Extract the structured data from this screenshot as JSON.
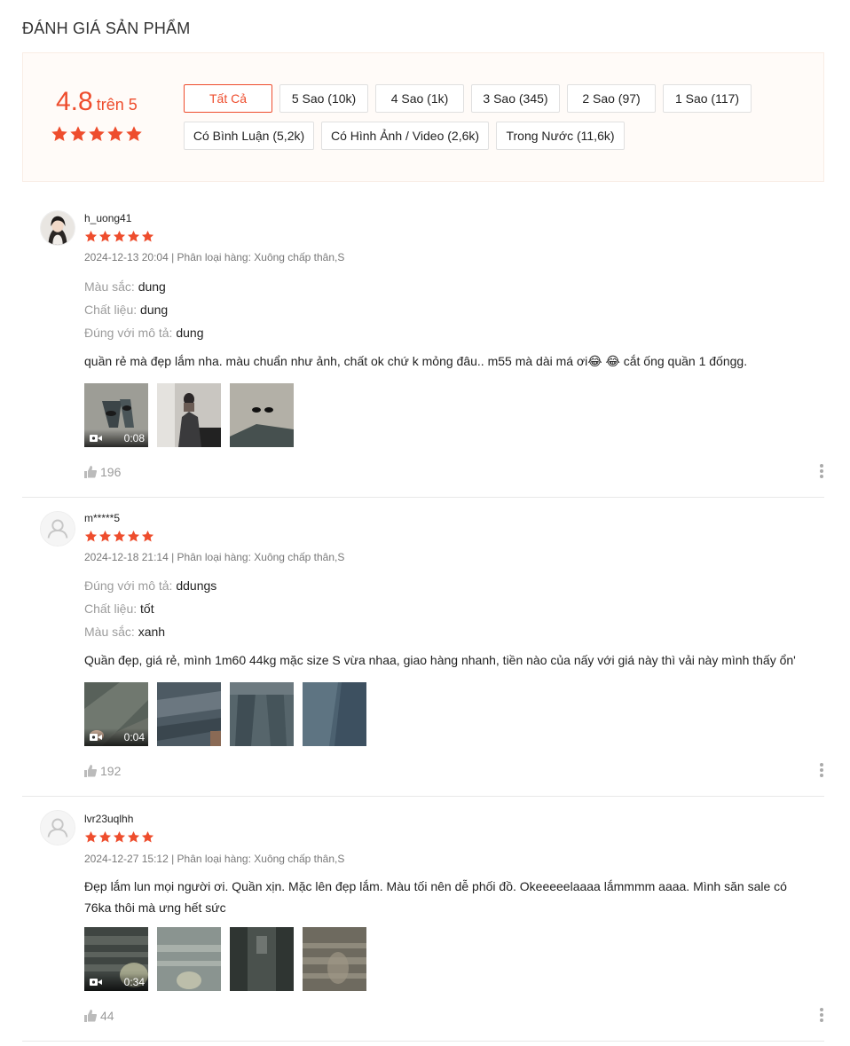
{
  "section_title": "ĐÁNH GIÁ SẢN PHẨM",
  "rating_overview": {
    "score": "4.8",
    "out_of": "trên 5",
    "stars_rating": 5,
    "filters": [
      {
        "label": "Tất Cả",
        "active": true
      },
      {
        "label": "5 Sao (10k)"
      },
      {
        "label": "4 Sao (1k)"
      },
      {
        "label": "3 Sao (345)"
      },
      {
        "label": "2 Sao (97)"
      },
      {
        "label": "1 Sao (117)"
      },
      {
        "label": "Có Bình Luận (5,2k)"
      },
      {
        "label": "Có Hình Ảnh / Video (2,6k)"
      },
      {
        "label": "Trong Nước (11,6k)"
      }
    ]
  },
  "colors": {
    "accent": "#ee4d2d",
    "star": "#ee4d2d",
    "overview_bg": "#fffbf8"
  },
  "reviews": [
    {
      "username": "h_uong41",
      "avatar": "photo",
      "stars": 5,
      "meta": "2024-12-13 20:04 | Phân loại hàng: Xuông chấp thân,S",
      "attributes": [
        {
          "key": "Màu sắc:",
          "value": "dung"
        },
        {
          "key": "Chất liệu:",
          "value": "dung"
        },
        {
          "key": "Đúng với mô tả:",
          "value": "dung"
        }
      ],
      "comment": "quần rẻ mà đẹp lắm nha. màu chuẩn như ảnh, chất ok chứ k mỏng đâu.. m55 mà dài má ơi😂 😂 cắt ống quần 1 đốngg.",
      "media": [
        {
          "type": "video",
          "duration": "0:08"
        },
        {
          "type": "image"
        },
        {
          "type": "image"
        }
      ],
      "likes": "196"
    },
    {
      "username": "m*****5",
      "avatar": "default",
      "stars": 5,
      "meta": "2024-12-18 21:14 | Phân loại hàng: Xuông chấp thân,S",
      "attributes": [
        {
          "key": "Đúng với mô tả:",
          "value": "ddungs"
        },
        {
          "key": "Chất liệu:",
          "value": "tốt"
        },
        {
          "key": "Màu sắc:",
          "value": "xanh"
        }
      ],
      "comment": "Quần đẹp, giá rẻ, mình 1m60 44kg mặc size S vừa nhaa, giao hàng nhanh, tiền nào của nấy với giá này thì vải này mình thấy ổn'",
      "media": [
        {
          "type": "video",
          "duration": "0:04"
        },
        {
          "type": "image"
        },
        {
          "type": "image"
        },
        {
          "type": "image"
        }
      ],
      "likes": "192"
    },
    {
      "username": "lvr23uqlhh",
      "avatar": "default",
      "stars": 5,
      "meta": "2024-12-27 15:12 | Phân loại hàng: Xuông chấp thân,S",
      "attributes": [],
      "comment": "Đẹp lắm lun mọi người ơi. Quần xịn. Mặc lên đẹp lắm. Màu tối nên dễ phối đồ. Okeeeeelaaaa lắmmmm aaaa. Mình săn sale có 76ka thôi mà ưng hết sức",
      "media": [
        {
          "type": "video",
          "duration": "0:34"
        },
        {
          "type": "image"
        },
        {
          "type": "image"
        },
        {
          "type": "image"
        }
      ],
      "likes": "44"
    }
  ]
}
